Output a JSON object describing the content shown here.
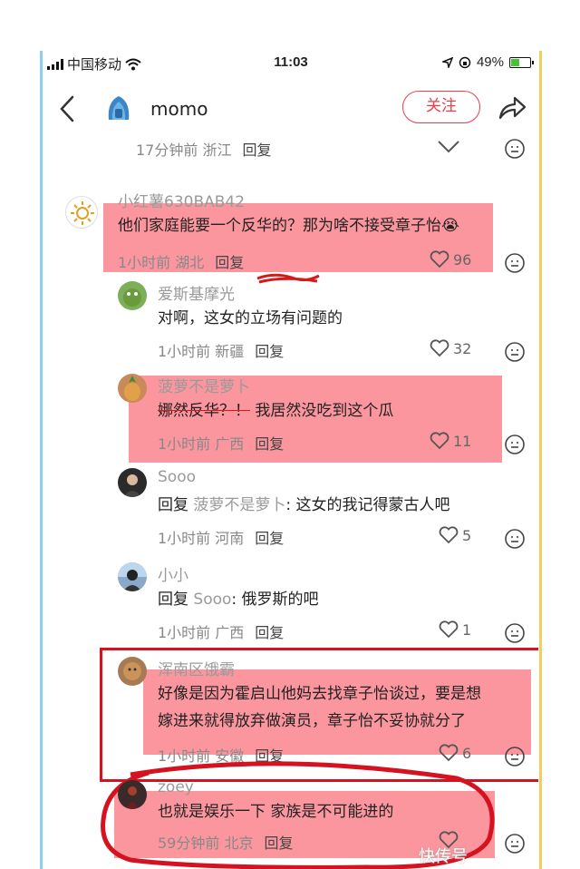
{
  "status_bar": {
    "carrier": "中国移动",
    "time": "11:03",
    "battery_text": "49%",
    "battery_level": 0.49
  },
  "header": {
    "back_icon": "chevron-left-icon",
    "title": "momo",
    "follow_label": "关注",
    "share_icon": "share-icon"
  },
  "comments": [
    {
      "id": "c0",
      "name": "",
      "text": "",
      "meta_time": "17分钟前 浙江",
      "reply_label": "回复",
      "likes": ""
    },
    {
      "id": "c1",
      "name": "小红薯630BAB42",
      "text_a": "他们家庭能要一个",
      "text_b": "反华的",
      "text_c": "？那为啥不接受章子怡",
      "meta_time": "1小时前 湖北",
      "reply_label": "回复",
      "likes": "96"
    },
    {
      "id": "c2",
      "name": "爱斯基摩光",
      "text": "对啊，这女的立场有问题的",
      "meta_time": "1小时前 新疆",
      "reply_label": "回复",
      "likes": "32"
    },
    {
      "id": "c3",
      "name": "菠萝不是萝卜",
      "text_strike": "娜然反华？！",
      "text": "我居然没吃到这个瓜",
      "meta_time": "1小时前 广西",
      "reply_label": "回复",
      "likes": "11"
    },
    {
      "id": "c4",
      "name": "Sooo",
      "reply_prefix": "回复",
      "reply_to": "菠萝不是萝卜",
      "text": ": 这女的我记得蒙古人吧",
      "meta_time": "1小时前 河南",
      "reply_label": "回复",
      "likes": "5"
    },
    {
      "id": "c5",
      "name": "小小",
      "reply_prefix": "回复",
      "reply_to": "Sooo",
      "text": ": 俄罗斯的吧",
      "meta_time": "1小时前 广西",
      "reply_label": "回复",
      "likes": "1"
    },
    {
      "id": "c6",
      "name": "浑南区饿霸",
      "text_line1": "好像是因为霍启山他妈去找章子怡谈过，要是想",
      "text_line2": "嫁进来就得放弃做演员，章子怡不妥协就分了",
      "meta_time": "1小时前 安徽",
      "reply_label": "回复",
      "likes": "6"
    },
    {
      "id": "c7",
      "name": "zoey",
      "text": "也就是娱乐一下 家族是不可能进的",
      "meta_time": "59分钟前 北京",
      "reply_label": "回复",
      "likes": ""
    }
  ],
  "watermark": "快传号",
  "colors": {
    "follow_red": "#e8404a",
    "highlight": "#fa6e78",
    "box_red": "#d51220"
  }
}
